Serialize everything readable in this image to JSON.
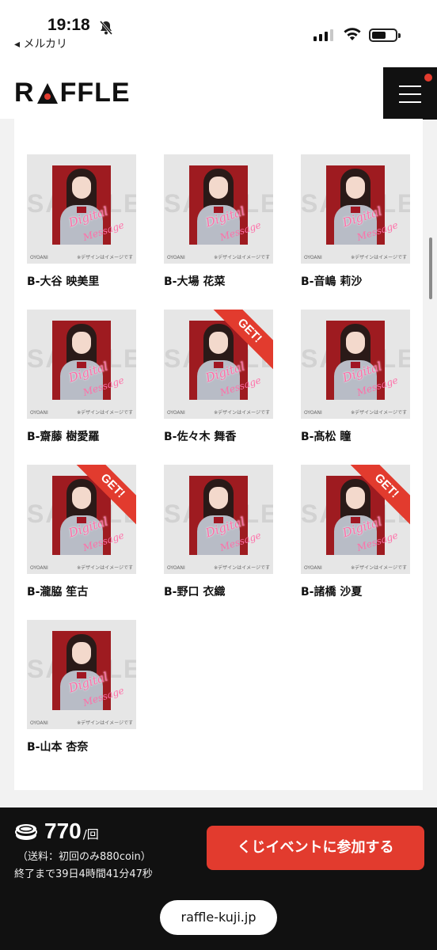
{
  "status_bar": {
    "time": "19:18",
    "back_label": "◂ メルカリ",
    "battery_level": 0.6
  },
  "header": {
    "logo_text_left": "R",
    "logo_text_right": "FFLE"
  },
  "items": [
    {
      "name": "B-大谷 映美里",
      "get": false
    },
    {
      "name": "B-大場 花菜",
      "get": false
    },
    {
      "name": "B-音嶋 莉沙",
      "get": false
    },
    {
      "name": "B-齋藤 樹愛羅",
      "get": false
    },
    {
      "name": "B-佐々木 舞香",
      "get": true
    },
    {
      "name": "B-髙松 瞳",
      "get": false
    },
    {
      "name": "B-瀧脇 笙古",
      "get": true
    },
    {
      "name": "B-野口 衣織",
      "get": false
    },
    {
      "name": "B-諸橋 沙夏",
      "get": true
    },
    {
      "name": "B-山本 杏奈",
      "get": false
    }
  ],
  "thumb": {
    "watermark": "SAMPLE",
    "script_line1": "Digital",
    "script_line2": "Message",
    "brand": "OYOANI",
    "note": "※デザインはイメージです",
    "get_label": "GET!"
  },
  "footer": {
    "price": "770",
    "per": "/回",
    "shipping": "（送料：初回のみ880coin）",
    "remaining": "終了まで39日4時間41分47秒",
    "join_button": "くじイベントに参加する",
    "url": "raffle-kuji.jp"
  },
  "colors": {
    "accent": "#e23b2e",
    "photo_bg": "#9e1b20"
  }
}
